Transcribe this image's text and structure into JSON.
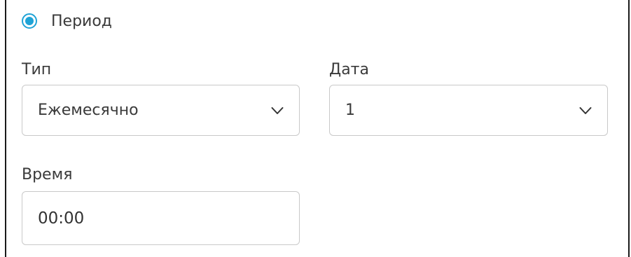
{
  "period": {
    "label": "Период",
    "selected": true
  },
  "type_field": {
    "label": "Тип",
    "value": "Ежемесячно",
    "icon": "chevron-down-icon"
  },
  "date_field": {
    "label": "Дата",
    "value": "1",
    "icon": "chevron-down-icon"
  },
  "time_field": {
    "label": "Время",
    "value": "00:00"
  },
  "colors": {
    "accent": "#1fa3d6",
    "border": "#c9c9c9",
    "text": "#3a3a3a",
    "frame": "#1a1a1a"
  }
}
